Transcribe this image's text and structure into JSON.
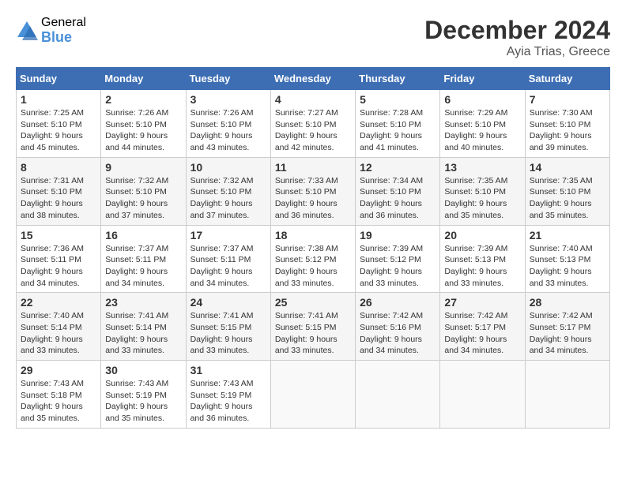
{
  "logo": {
    "general": "General",
    "blue": "Blue"
  },
  "header": {
    "title": "December 2024",
    "location": "Ayia Trias, Greece"
  },
  "weekdays": [
    "Sunday",
    "Monday",
    "Tuesday",
    "Wednesday",
    "Thursday",
    "Friday",
    "Saturday"
  ],
  "weeks": [
    [
      {
        "day": "1",
        "sunrise": "7:25 AM",
        "sunset": "5:10 PM",
        "daylight": "9 hours and 45 minutes."
      },
      {
        "day": "2",
        "sunrise": "7:26 AM",
        "sunset": "5:10 PM",
        "daylight": "9 hours and 44 minutes."
      },
      {
        "day": "3",
        "sunrise": "7:26 AM",
        "sunset": "5:10 PM",
        "daylight": "9 hours and 43 minutes."
      },
      {
        "day": "4",
        "sunrise": "7:27 AM",
        "sunset": "5:10 PM",
        "daylight": "9 hours and 42 minutes."
      },
      {
        "day": "5",
        "sunrise": "7:28 AM",
        "sunset": "5:10 PM",
        "daylight": "9 hours and 41 minutes."
      },
      {
        "day": "6",
        "sunrise": "7:29 AM",
        "sunset": "5:10 PM",
        "daylight": "9 hours and 40 minutes."
      },
      {
        "day": "7",
        "sunrise": "7:30 AM",
        "sunset": "5:10 PM",
        "daylight": "9 hours and 39 minutes."
      }
    ],
    [
      {
        "day": "8",
        "sunrise": "7:31 AM",
        "sunset": "5:10 PM",
        "daylight": "9 hours and 38 minutes."
      },
      {
        "day": "9",
        "sunrise": "7:32 AM",
        "sunset": "5:10 PM",
        "daylight": "9 hours and 37 minutes."
      },
      {
        "day": "10",
        "sunrise": "7:32 AM",
        "sunset": "5:10 PM",
        "daylight": "9 hours and 37 minutes."
      },
      {
        "day": "11",
        "sunrise": "7:33 AM",
        "sunset": "5:10 PM",
        "daylight": "9 hours and 36 minutes."
      },
      {
        "day": "12",
        "sunrise": "7:34 AM",
        "sunset": "5:10 PM",
        "daylight": "9 hours and 36 minutes."
      },
      {
        "day": "13",
        "sunrise": "7:35 AM",
        "sunset": "5:10 PM",
        "daylight": "9 hours and 35 minutes."
      },
      {
        "day": "14",
        "sunrise": "7:35 AM",
        "sunset": "5:10 PM",
        "daylight": "9 hours and 35 minutes."
      }
    ],
    [
      {
        "day": "15",
        "sunrise": "7:36 AM",
        "sunset": "5:11 PM",
        "daylight": "9 hours and 34 minutes."
      },
      {
        "day": "16",
        "sunrise": "7:37 AM",
        "sunset": "5:11 PM",
        "daylight": "9 hours and 34 minutes."
      },
      {
        "day": "17",
        "sunrise": "7:37 AM",
        "sunset": "5:11 PM",
        "daylight": "9 hours and 34 minutes."
      },
      {
        "day": "18",
        "sunrise": "7:38 AM",
        "sunset": "5:12 PM",
        "daylight": "9 hours and 33 minutes."
      },
      {
        "day": "19",
        "sunrise": "7:39 AM",
        "sunset": "5:12 PM",
        "daylight": "9 hours and 33 minutes."
      },
      {
        "day": "20",
        "sunrise": "7:39 AM",
        "sunset": "5:13 PM",
        "daylight": "9 hours and 33 minutes."
      },
      {
        "day": "21",
        "sunrise": "7:40 AM",
        "sunset": "5:13 PM",
        "daylight": "9 hours and 33 minutes."
      }
    ],
    [
      {
        "day": "22",
        "sunrise": "7:40 AM",
        "sunset": "5:14 PM",
        "daylight": "9 hours and 33 minutes."
      },
      {
        "day": "23",
        "sunrise": "7:41 AM",
        "sunset": "5:14 PM",
        "daylight": "9 hours and 33 minutes."
      },
      {
        "day": "24",
        "sunrise": "7:41 AM",
        "sunset": "5:15 PM",
        "daylight": "9 hours and 33 minutes."
      },
      {
        "day": "25",
        "sunrise": "7:41 AM",
        "sunset": "5:15 PM",
        "daylight": "9 hours and 33 minutes."
      },
      {
        "day": "26",
        "sunrise": "7:42 AM",
        "sunset": "5:16 PM",
        "daylight": "9 hours and 34 minutes."
      },
      {
        "day": "27",
        "sunrise": "7:42 AM",
        "sunset": "5:17 PM",
        "daylight": "9 hours and 34 minutes."
      },
      {
        "day": "28",
        "sunrise": "7:42 AM",
        "sunset": "5:17 PM",
        "daylight": "9 hours and 34 minutes."
      }
    ],
    [
      {
        "day": "29",
        "sunrise": "7:43 AM",
        "sunset": "5:18 PM",
        "daylight": "9 hours and 35 minutes."
      },
      {
        "day": "30",
        "sunrise": "7:43 AM",
        "sunset": "5:19 PM",
        "daylight": "9 hours and 35 minutes."
      },
      {
        "day": "31",
        "sunrise": "7:43 AM",
        "sunset": "5:19 PM",
        "daylight": "9 hours and 36 minutes."
      },
      null,
      null,
      null,
      null
    ]
  ]
}
